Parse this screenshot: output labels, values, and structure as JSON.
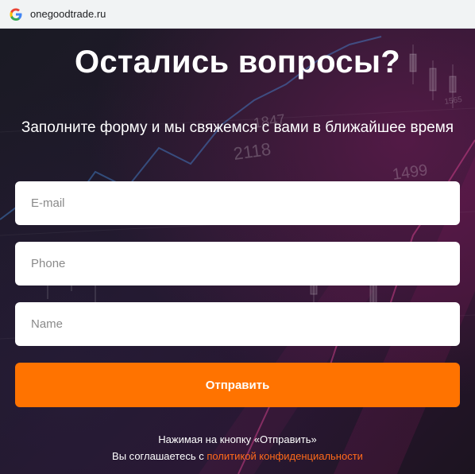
{
  "browser": {
    "url": "onegoodtrade.ru"
  },
  "hero": {
    "title": "Остались вопросы?",
    "subtitle": "Заполните форму и мы свяжемся с вами в ближайшее время"
  },
  "form": {
    "email_placeholder": "E-mail",
    "phone_placeholder": "Phone",
    "name_placeholder": "Name",
    "submit_label": "Отправить"
  },
  "consent": {
    "line1": "Нажимая на кнопку «Отправить»",
    "line2_prefix": "Вы соглашаетесь с ",
    "policy_link": "политикой конфиденциальности"
  },
  "background_numbers": [
    "1847",
    "2118",
    "1499",
    "1565"
  ],
  "colors": {
    "accent": "#ff7300",
    "link": "#ff6a1a"
  }
}
